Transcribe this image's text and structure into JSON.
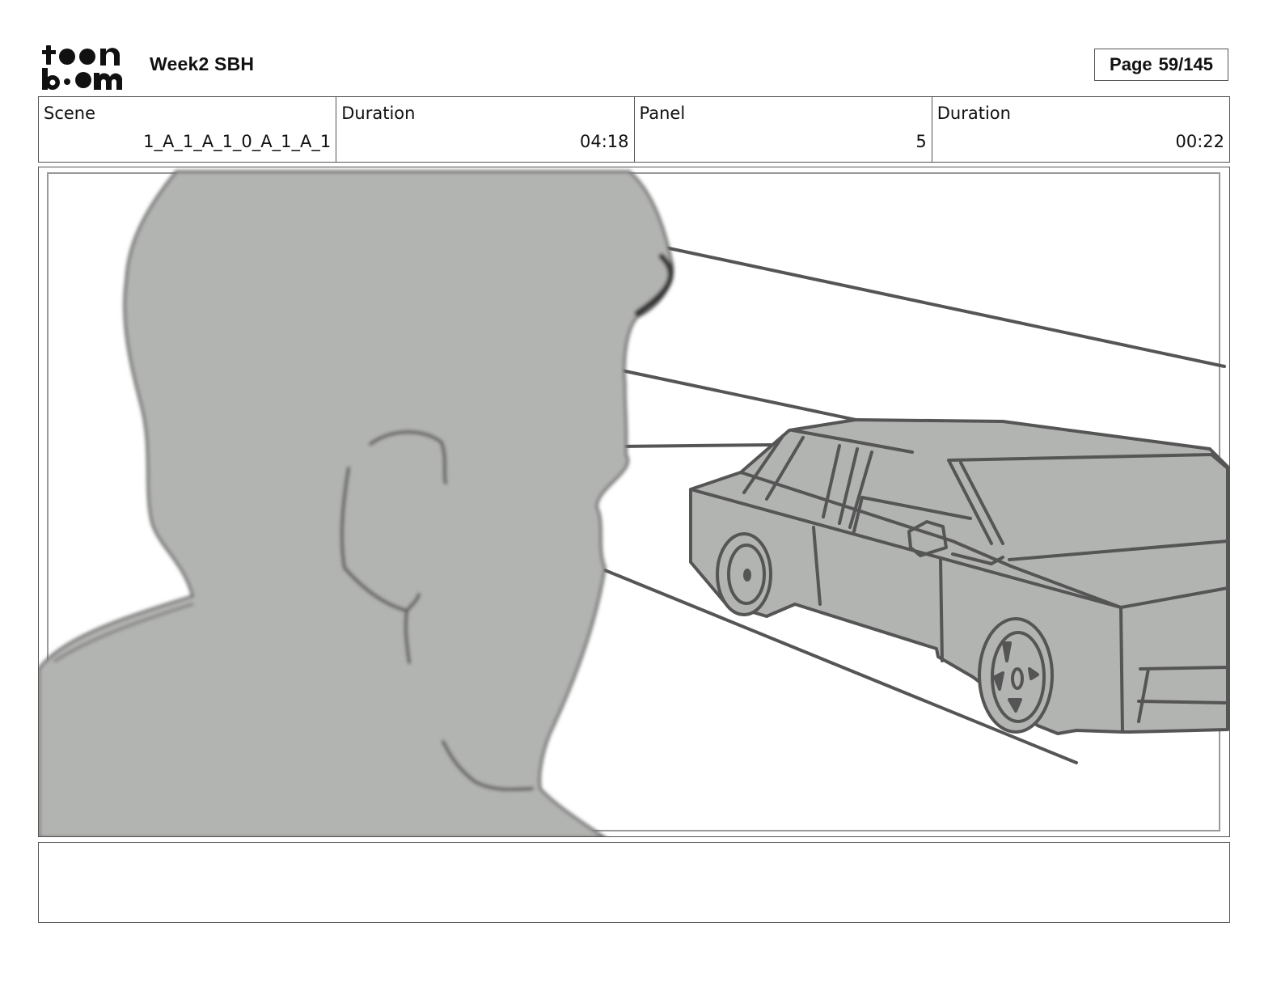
{
  "header": {
    "logo_text": "toon boom",
    "project_title": "Week2 SBH",
    "page_label": "Page",
    "page_number": "59/145"
  },
  "info": {
    "scene_label": "Scene",
    "scene_value": "1_A_1_A_1_0_A_1_A_1",
    "scene_duration_label": "Duration",
    "scene_duration_value": "04:18",
    "panel_label": "Panel",
    "panel_value": "5",
    "panel_duration_label": "Duration",
    "panel_duration_value": "00:22"
  },
  "panel": {
    "fill_color": "#b2b4b1",
    "line_color": "#555555"
  },
  "notes": {
    "text": ""
  }
}
